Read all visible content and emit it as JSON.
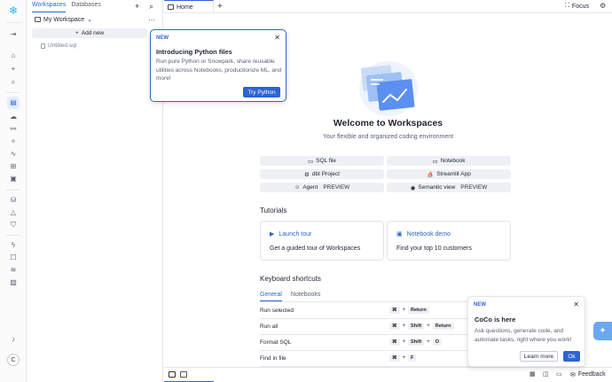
{
  "sidebar": {
    "tabs": [
      "Workspaces",
      "Databases"
    ],
    "workspace_name": "My Workspace",
    "add_new": "Add new",
    "files": [
      "Untitled.sql"
    ]
  },
  "topbar": {
    "home_tab": "Home",
    "focus": "Focus"
  },
  "main": {
    "welcome_title": "Welcome to Workspaces",
    "welcome_subtitle": "Your flexible and organized coding environment",
    "create_options": [
      {
        "label": "SQL file",
        "icon": "file-icon"
      },
      {
        "label": "Notebook",
        "icon": "notebook-icon"
      },
      {
        "label": "dbt Project",
        "icon": "dbt-icon"
      },
      {
        "label": "Streamlit App",
        "icon": "streamlit-icon"
      },
      {
        "label": "Agent",
        "tag": "PREVIEW",
        "icon": "agent-icon"
      },
      {
        "label": "Semantic view",
        "tag": "PREVIEW",
        "icon": "eye-icon"
      }
    ],
    "tutorials_title": "Tutorials",
    "tutorials": [
      {
        "title": "Launch tour",
        "desc": "Get a guided tour of Workspaces"
      },
      {
        "title": "Notebook demo",
        "desc": "Find your top 10 customers"
      }
    ],
    "shortcuts_title": "Keyboard shortcuts",
    "shortcut_tabs": [
      "General",
      "Notebooks"
    ],
    "shortcuts": [
      {
        "label": "Run selected",
        "keys": [
          "⌘",
          "Return"
        ]
      },
      {
        "label": "Run all",
        "keys": [
          "⌘",
          "Shift",
          "Return"
        ]
      },
      {
        "label": "Format SQL",
        "keys": [
          "⌘",
          "Shift",
          "O"
        ]
      },
      {
        "label": "Find in file",
        "keys": [
          "⌘",
          "F"
        ]
      }
    ]
  },
  "python_popover": {
    "badge": "NEW",
    "title": "Introducing Python files",
    "description": "Run pure Python or Snowpark, share reusable utilities across Notebooks, productionize ML, and more!",
    "button": "Try Python"
  },
  "coco_popover": {
    "badge": "NEW",
    "title": "CoCo is here",
    "description": "Ask questions, generate code, and automate tasks, right where you work!",
    "learn_more": "Learn more",
    "ok": "Ok"
  },
  "bottombar": {
    "feedback": "Feedback"
  },
  "rail": {
    "avatar_initial": "C"
  }
}
